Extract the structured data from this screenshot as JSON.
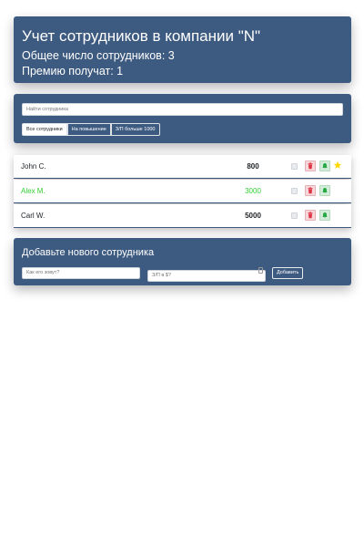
{
  "info": {
    "title": "Учет сотрудников в компании \"N\"",
    "total_line": "Общее число сотрудников: 3",
    "bonus_line": "Премию получат: 1"
  },
  "search": {
    "placeholder": "Найти сотрудника"
  },
  "filters": [
    {
      "label": "Все сотрудники",
      "active": true
    },
    {
      "label": "На повышение",
      "active": false
    },
    {
      "label": "З/П больше 1000",
      "active": false
    }
  ],
  "employees": [
    {
      "name": "John C.",
      "salary": "800",
      "increase": false,
      "star": true
    },
    {
      "name": "Alex M.",
      "salary": "3000",
      "increase": true,
      "star": false
    },
    {
      "name": "Carl W.",
      "salary": "5000",
      "increase": false,
      "star": false
    }
  ],
  "icons": {
    "row_left": "cookie-icon",
    "trash": "trash-icon",
    "bell": "bell-icon",
    "star": "star-icon"
  },
  "colors": {
    "panel": "#3d5a80",
    "increase": "#32cd32",
    "trash": "#dc3545",
    "bell": "#28a745",
    "star": "#ffd700"
  },
  "add_form": {
    "title": "Добавьте нового сотрудника",
    "name_placeholder": "Как его зовут?",
    "salary_placeholder": "З/П в $?",
    "submit_label": "Добавить"
  }
}
